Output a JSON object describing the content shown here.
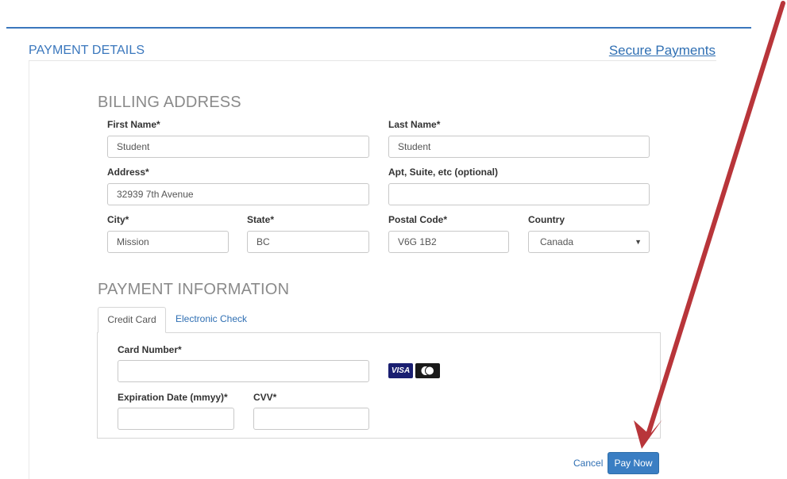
{
  "header": {
    "title": "PAYMENT DETAILS",
    "secure_link": "Secure Payments"
  },
  "billing": {
    "title": "BILLING ADDRESS",
    "first_name": {
      "label": "First Name*",
      "value": "Student"
    },
    "last_name": {
      "label": "Last Name*",
      "value": "Student"
    },
    "address": {
      "label": "Address*",
      "value": "32939 7th Avenue"
    },
    "apt": {
      "label": "Apt, Suite, etc (optional)",
      "value": ""
    },
    "city": {
      "label": "City*",
      "value": "Mission"
    },
    "state": {
      "label": "State*",
      "value": "BC"
    },
    "postal": {
      "label": "Postal Code*",
      "value": "V6G 1B2"
    },
    "country": {
      "label": "Country",
      "value": "Canada"
    }
  },
  "payment": {
    "title": "PAYMENT INFORMATION",
    "tabs": [
      {
        "label": "Credit Card",
        "active": true
      },
      {
        "label": "Electronic Check",
        "active": false
      }
    ],
    "card_number": {
      "label": "Card Number*",
      "value": ""
    },
    "expiration": {
      "label": "Expiration Date (mmyy)*",
      "value": ""
    },
    "cvv": {
      "label": "CVV*",
      "value": ""
    },
    "card_logos": [
      "visa-icon",
      "mastercard-icon"
    ],
    "visa_text": "VISA"
  },
  "actions": {
    "cancel": "Cancel",
    "pay_now": "Pay Now"
  },
  "colors": {
    "accent": "#3a77bd",
    "button": "#3a7ec3",
    "annotation_arrow": "#b8353a"
  }
}
